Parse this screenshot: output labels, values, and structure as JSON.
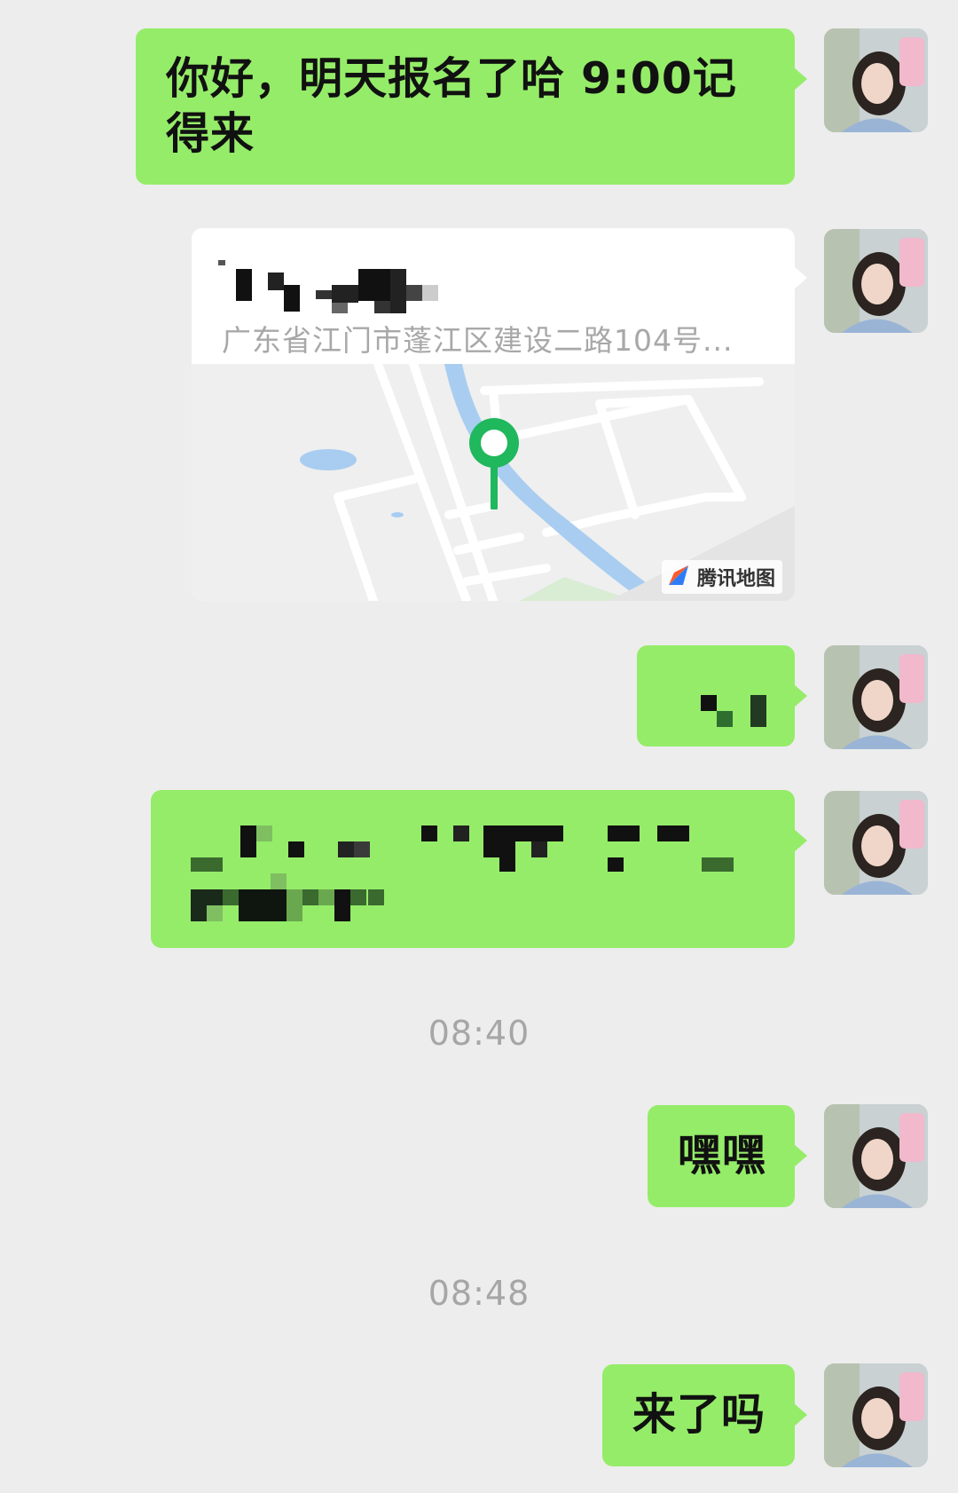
{
  "chat": {
    "msg1": {
      "text": "你好，明天报名了哈 9:00记得来"
    },
    "location": {
      "address": "广东省江门市蓬江区建设二路104号...",
      "map_brand": "腾讯地图"
    },
    "time1": "08:40",
    "msg_heihei": {
      "text": "嘿嘿"
    },
    "time2": "08:48",
    "msg_laile": {
      "text": "来了吗"
    }
  },
  "colors": {
    "outgoing_bubble": "#95ec69",
    "background": "#ededed",
    "map_pin": "#1fb85c",
    "river": "#a8cdf0"
  },
  "icons": {
    "map_pin": "location-pin-icon",
    "map_brand_logo": "tencent-map-logo"
  }
}
